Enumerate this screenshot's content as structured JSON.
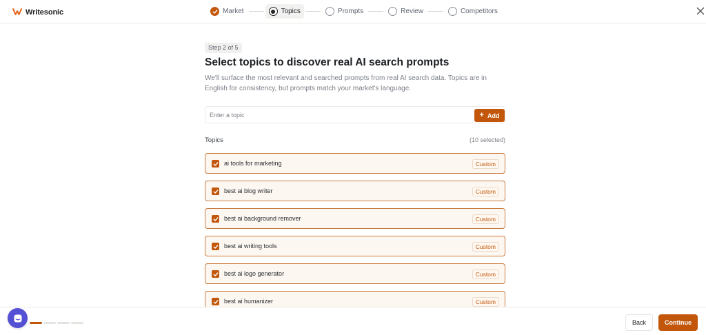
{
  "brand": {
    "name": "Writesonic",
    "icon": "writesonic-logo"
  },
  "stepper": [
    {
      "label": "Market",
      "state": "done"
    },
    {
      "label": "Topics",
      "state": "current"
    },
    {
      "label": "Prompts",
      "state": "todo"
    },
    {
      "label": "Review",
      "state": "todo"
    },
    {
      "label": "Competitors",
      "state": "todo"
    }
  ],
  "main": {
    "step_badge": "Step 2 of 5",
    "title": "Select topics to discover real AI search prompts",
    "description": "We'll surface the most relevant and searched prompts from real AI search data. Topics are in English for consistency, but prompts match your market's language.",
    "input_placeholder": "Enter a topic",
    "input_value": "",
    "add_label": "Add",
    "topics_label": "Topics",
    "selected_count": "(10 selected)",
    "topics": [
      {
        "label": "ai tools for marketing",
        "badge": "Custom",
        "checked": true
      },
      {
        "label": "best ai blog writer",
        "badge": "Custom",
        "checked": true
      },
      {
        "label": "best ai background remover",
        "badge": "Custom",
        "checked": true
      },
      {
        "label": "best ai writing tools",
        "badge": "Custom",
        "checked": true
      },
      {
        "label": "best ai logo generator",
        "badge": "Custom",
        "checked": true
      },
      {
        "label": "best ai humanizer",
        "badge": "Custom",
        "checked": true
      }
    ]
  },
  "footer": {
    "back_label": "Back",
    "continue_label": "Continue",
    "progress_current": 1,
    "progress_total": 4
  },
  "colors": {
    "accent": "#c2570c",
    "topic_bg": "#fdf7f1",
    "topic_border": "#c87a3d",
    "chat": "#5450d6"
  }
}
